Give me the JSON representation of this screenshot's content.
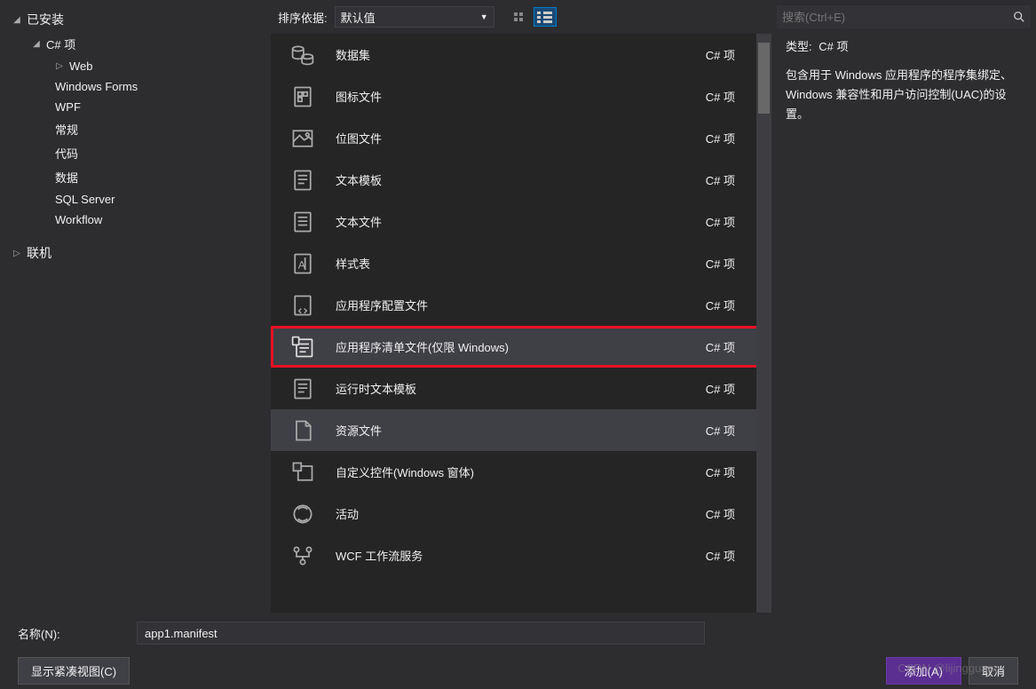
{
  "sidebar": {
    "root": "已安装",
    "category": "C# 项",
    "items": [
      "Web",
      "Windows Forms",
      "WPF",
      "常规",
      "代码",
      "数据",
      "SQL Server",
      "Workflow"
    ],
    "online": "联机"
  },
  "toolbar": {
    "sort_label": "排序依据:",
    "sort_value": "默认值"
  },
  "items": [
    {
      "label": "数据集",
      "tag": "C# 项",
      "icon": "dataset"
    },
    {
      "label": "图标文件",
      "tag": "C# 项",
      "icon": "icon-file"
    },
    {
      "label": "位图文件",
      "tag": "C# 项",
      "icon": "bitmap"
    },
    {
      "label": "文本模板",
      "tag": "C# 项",
      "icon": "text-template"
    },
    {
      "label": "文本文件",
      "tag": "C# 项",
      "icon": "text-file"
    },
    {
      "label": "样式表",
      "tag": "C# 项",
      "icon": "stylesheet"
    },
    {
      "label": "应用程序配置文件",
      "tag": "C# 项",
      "icon": "app-config"
    },
    {
      "label": "应用程序清单文件(仅限 Windows)",
      "tag": "C# 项",
      "icon": "manifest",
      "highlighted": true
    },
    {
      "label": "运行时文本模板",
      "tag": "C# 项",
      "icon": "runtime-template"
    },
    {
      "label": "资源文件",
      "tag": "C# 项",
      "icon": "resource",
      "hover": true
    },
    {
      "label": "自定义控件(Windows 窗体)",
      "tag": "C# 项",
      "icon": "custom-control"
    },
    {
      "label": "活动",
      "tag": "C# 项",
      "icon": "activity"
    },
    {
      "label": "WCF 工作流服务",
      "tag": "C# 项",
      "icon": "wcf"
    }
  ],
  "search": {
    "placeholder": "搜索(Ctrl+E)"
  },
  "detail": {
    "type_label": "类型:",
    "type_value": "C# 项",
    "description": "包含用于 Windows 应用程序的程序集绑定、Windows 兼容性和用户访问控制(UAC)的设置。"
  },
  "footer": {
    "name_label": "名称(N):",
    "name_value": "app1.manifest",
    "compact_view": "显示紧凑视图(C)",
    "add": "添加(A)",
    "cancel": "取消"
  },
  "watermark": "CSDN @lijingguang"
}
